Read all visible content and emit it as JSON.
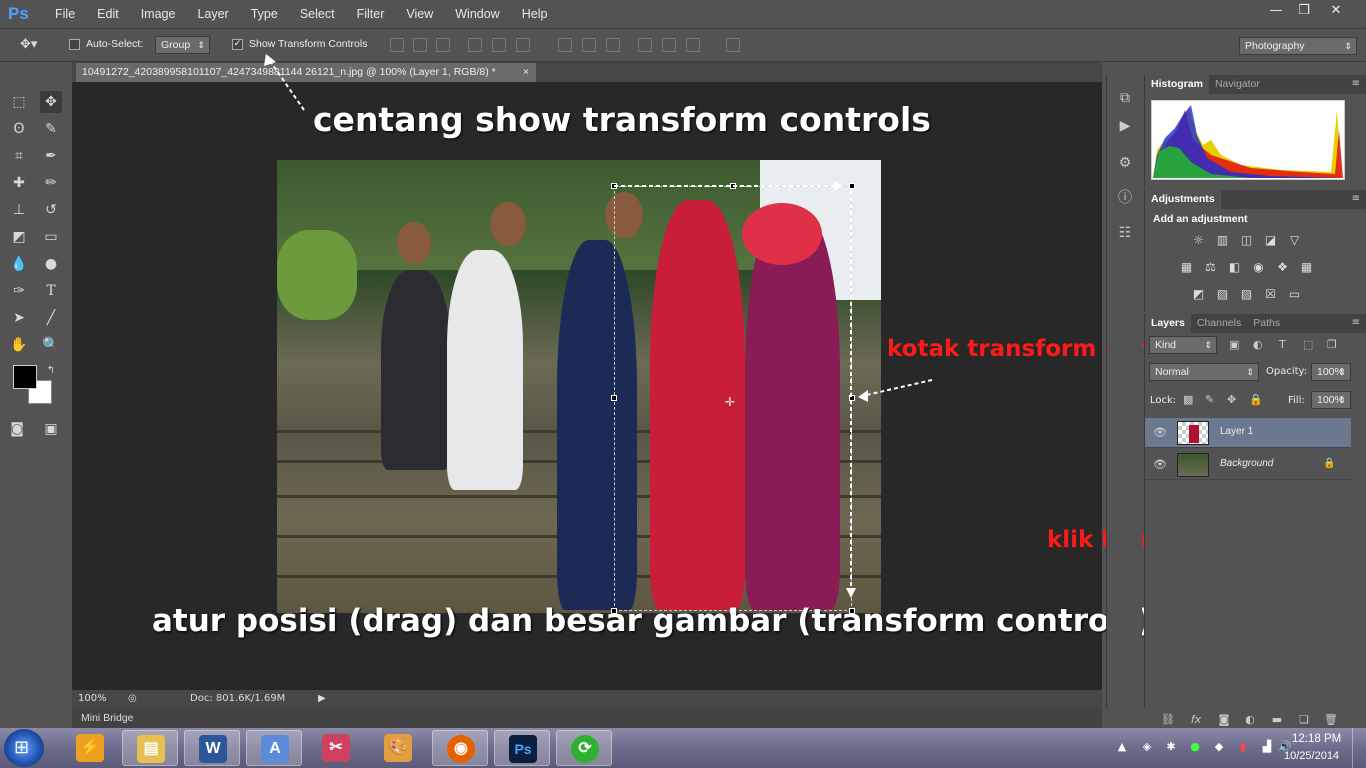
{
  "app": {
    "logo": "Ps"
  },
  "menu": [
    "File",
    "Edit",
    "Image",
    "Layer",
    "Type",
    "Select",
    "Filter",
    "View",
    "Window",
    "Help"
  ],
  "window_controls": {
    "minimize": "—",
    "restore": "❐",
    "close": "✕"
  },
  "options": {
    "auto_select_label": "Auto-Select:",
    "auto_select_checked": false,
    "group_value": "Group",
    "show_transform_label": "Show Transform Controls",
    "show_transform_checked": true,
    "workspace": "Photography"
  },
  "document": {
    "tab_title": "10491272_420389958101107_4247349881144 26121_n.jpg @ 100% (Layer 1, RGB/8) *",
    "close": "×"
  },
  "annotations": {
    "top": "centang show transform controls",
    "transform_box": "kotak transform controls",
    "merge": "klik kanan, merge down",
    "bottom": "atur posisi (drag) dan besar gambar (transform controls)"
  },
  "status": {
    "zoom": "100%",
    "doc": "Doc: 801.6K/1.69M"
  },
  "mini_bridge": "Mini Bridge",
  "panels": {
    "histogram_tabs": [
      "Histogram",
      "Navigator"
    ],
    "adjustments_title": "Adjustments",
    "adjustments_subtitle": "Add an adjustment",
    "layers_tabs": [
      "Layers",
      "Channels",
      "Paths"
    ],
    "kind": "Kind",
    "blend_mode": "Normal",
    "opacity_label": "Opacity:",
    "opacity_value": "100%",
    "lock_label": "Lock:",
    "fill_label": "Fill:",
    "fill_value": "100%",
    "layers": [
      {
        "name": "Layer 1",
        "selected": true
      },
      {
        "name": "Background",
        "locked": true
      }
    ]
  },
  "taskbar": {
    "time": "12:18 PM",
    "date": "10/25/2014",
    "apps": [
      "Windows Explorer",
      "Microsoft Word",
      "WordPad",
      "Paint",
      "Firefox",
      "Photoshop",
      "Download"
    ]
  },
  "colors": {
    "accent": "#4aa4ff",
    "annotation_red": "#ff1a1a",
    "annotation_white": "#ffffff"
  }
}
